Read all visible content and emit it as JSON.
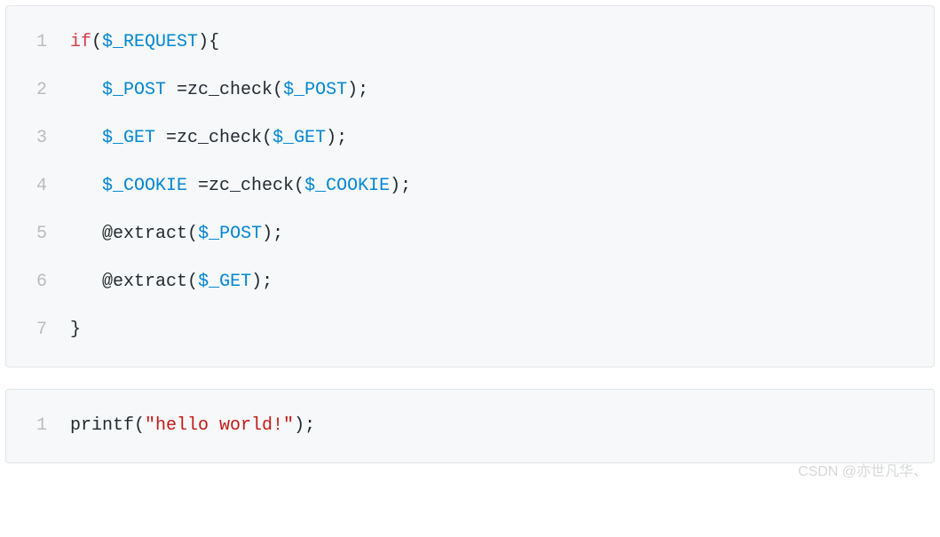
{
  "blocks": [
    {
      "lines": [
        {
          "num": "1",
          "tokens": [
            {
              "t": "if",
              "c": "tok-keyword"
            },
            {
              "t": "(",
              "c": "tok-punct"
            },
            {
              "t": "$_REQUEST",
              "c": "tok-variable"
            },
            {
              "t": "){",
              "c": "tok-punct"
            }
          ]
        },
        {
          "num": "2",
          "indent": "   ",
          "tokens": [
            {
              "t": "$_POST",
              "c": "tok-variable"
            },
            {
              "t": " =zc_check(",
              "c": "tok-punct"
            },
            {
              "t": "$_POST",
              "c": "tok-variable"
            },
            {
              "t": ");",
              "c": "tok-punct"
            }
          ]
        },
        {
          "num": "3",
          "indent": "   ",
          "tokens": [
            {
              "t": "$_GET",
              "c": "tok-variable"
            },
            {
              "t": " =zc_check(",
              "c": "tok-punct"
            },
            {
              "t": "$_GET",
              "c": "tok-variable"
            },
            {
              "t": ");",
              "c": "tok-punct"
            }
          ]
        },
        {
          "num": "4",
          "indent": "   ",
          "tokens": [
            {
              "t": "$_COOKIE",
              "c": "tok-variable"
            },
            {
              "t": " =zc_check(",
              "c": "tok-punct"
            },
            {
              "t": "$_COOKIE",
              "c": "tok-variable"
            },
            {
              "t": ");",
              "c": "tok-punct"
            }
          ]
        },
        {
          "num": "5",
          "indent": "   ",
          "tokens": [
            {
              "t": "@",
              "c": "tok-at"
            },
            {
              "t": "extract",
              "c": "tok-func"
            },
            {
              "t": "(",
              "c": "tok-punct"
            },
            {
              "t": "$_POST",
              "c": "tok-variable"
            },
            {
              "t": ");",
              "c": "tok-punct"
            }
          ]
        },
        {
          "num": "6",
          "indent": "   ",
          "tokens": [
            {
              "t": "@",
              "c": "tok-at"
            },
            {
              "t": "extract",
              "c": "tok-func"
            },
            {
              "t": "(",
              "c": "tok-punct"
            },
            {
              "t": "$_GET",
              "c": "tok-variable"
            },
            {
              "t": ");",
              "c": "tok-punct"
            }
          ]
        },
        {
          "num": "7",
          "tokens": [
            {
              "t": "}",
              "c": "tok-punct"
            }
          ]
        }
      ]
    },
    {
      "lines": [
        {
          "num": "1",
          "tokens": [
            {
              "t": "printf",
              "c": "tok-func"
            },
            {
              "t": "(",
              "c": "tok-punct"
            },
            {
              "t": "\"hello world!\"",
              "c": "tok-string"
            },
            {
              "t": ");",
              "c": "tok-punct"
            }
          ]
        }
      ]
    }
  ],
  "watermark": "CSDN @亦世凡华、"
}
